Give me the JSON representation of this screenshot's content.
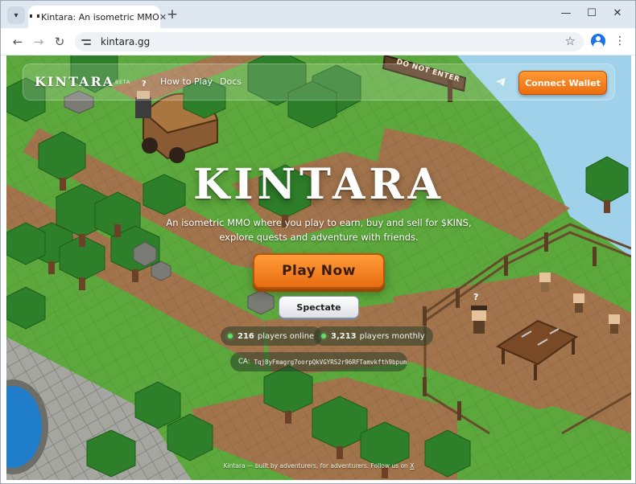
{
  "browser": {
    "tab_title": "Kintara: An isometric MMO",
    "url": "kintara.gg",
    "icons": {
      "tab_list": "chevron-down-icon",
      "close_tab": "close-icon",
      "new_tab": "plus-icon",
      "minimize": "minimize-icon",
      "maximize": "maximize-icon",
      "close_window": "close-icon",
      "back": "back-arrow-icon",
      "forward": "forward-arrow-icon",
      "reload": "reload-icon",
      "site_info": "tune-icon",
      "bookmark": "star-icon",
      "profile": "profile-icon",
      "menu": "more-vertical-icon"
    }
  },
  "header": {
    "logo": "KINTARA",
    "badge": "BETA",
    "nav": [
      "How to Play",
      "Docs"
    ],
    "telegram_icon": "telegram-icon",
    "connect_wallet": "Connect Wallet"
  },
  "hero": {
    "title": "KINTARA",
    "tagline": "An isometric MMO where you play to earn, buy and sell for $KINS, explore quests and adventure with friends.",
    "play_now": "Play Now",
    "spectate": "Spectate"
  },
  "stats": {
    "online_count": "216",
    "online_label": "players online",
    "monthly_count": "3,213",
    "monthly_label": "players monthly"
  },
  "contract": {
    "label": "CA:",
    "address": "Tqj8yFmagrg7oorpQkVGYRS2r96RFTamvkfth9bpump"
  },
  "footer": {
    "text": "Kintara — built by adventurers, for adventurers. Follow us on",
    "link": "X"
  },
  "scene": {
    "sign": "DO NOT ENTER",
    "npc_question_mark": "?"
  },
  "colors": {
    "accent_orange": "#f07d1e",
    "grass": "#5aa33b",
    "dirt_path": "#a0714a",
    "stone": "#9a9a94",
    "water": "#2b8fd6",
    "online_dot": "#5fe06a"
  }
}
